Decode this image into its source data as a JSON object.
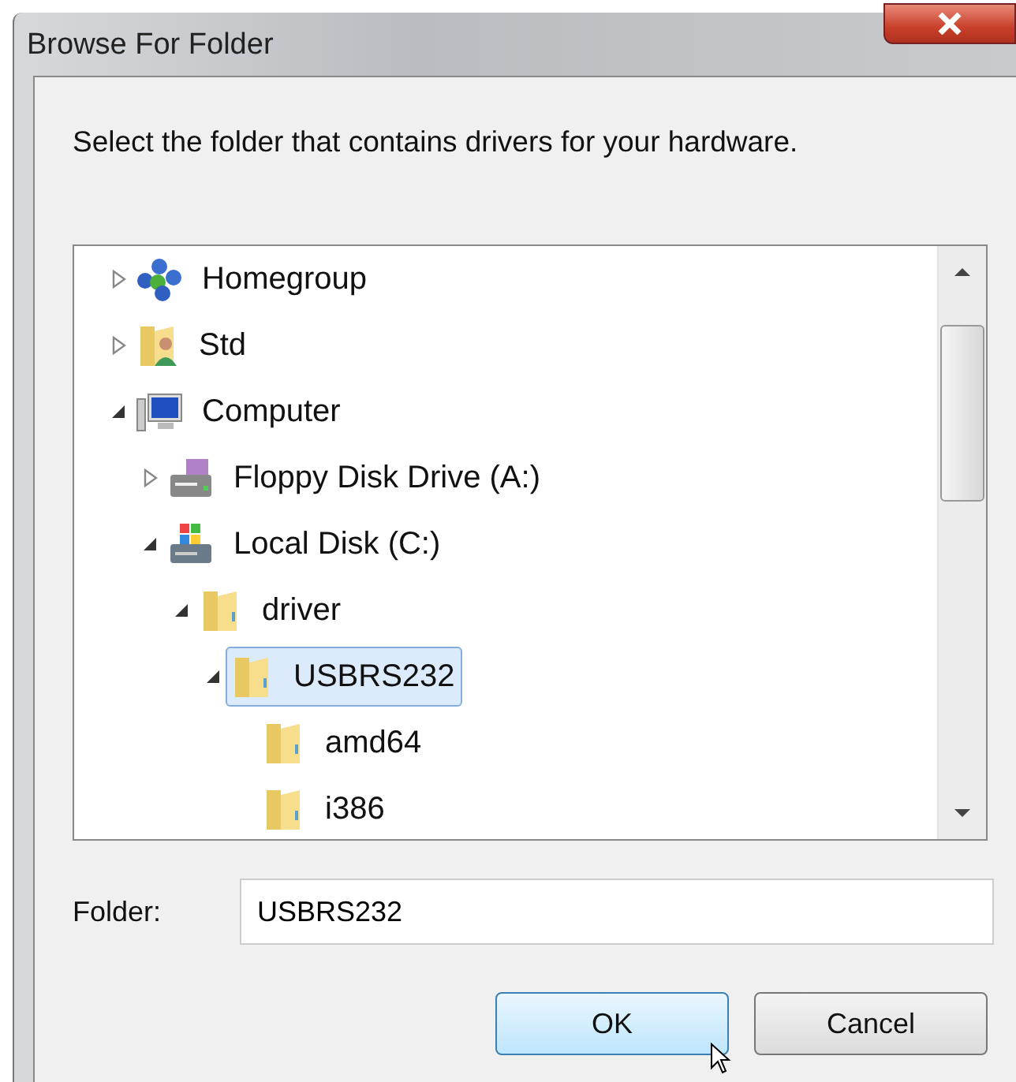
{
  "window": {
    "title": "Browse For Folder"
  },
  "instruction": "Select the folder that contains drivers for your hardware.",
  "tree": [
    {
      "label": "Homegroup",
      "kind": "homegroup",
      "expanded": false,
      "selected": false
    },
    {
      "label": "Std",
      "kind": "user-folder",
      "expanded": false,
      "selected": false
    },
    {
      "label": "Computer",
      "kind": "computer",
      "expanded": true,
      "selected": false,
      "children": [
        {
          "label": "Floppy Disk Drive (A:)",
          "kind": "floppy",
          "expanded": false,
          "selected": false
        },
        {
          "label": "Local Disk (C:)",
          "kind": "disk",
          "expanded": true,
          "selected": false,
          "children": [
            {
              "label": "driver",
              "kind": "folder",
              "expanded": true,
              "selected": false,
              "children": [
                {
                  "label": "USBRS232",
                  "kind": "folder",
                  "expanded": true,
                  "selected": true,
                  "children": [
                    {
                      "label": "amd64",
                      "kind": "folder",
                      "selected": false
                    },
                    {
                      "label": "i386",
                      "kind": "folder",
                      "selected": false
                    }
                  ]
                }
              ]
            }
          ]
        }
      ]
    }
  ],
  "folder": {
    "label": "Folder:",
    "value": "USBRS232"
  },
  "buttons": [
    {
      "label": "OK",
      "focused": true
    },
    {
      "label": "Cancel",
      "focused": false
    }
  ]
}
